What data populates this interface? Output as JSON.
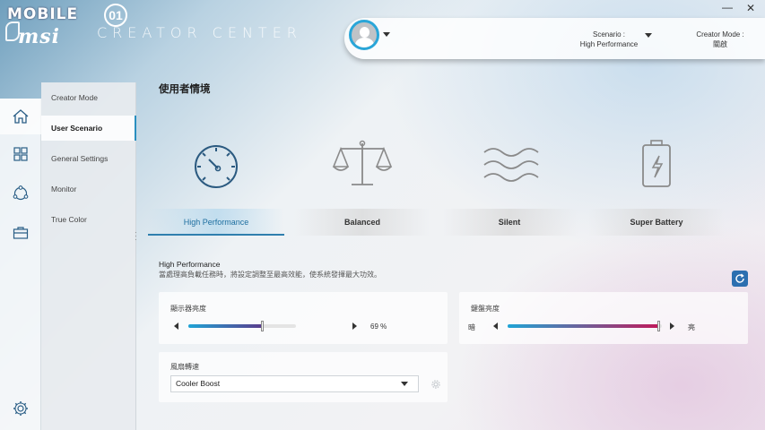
{
  "header": {
    "brand_text": "MOBILE",
    "brand_badge": "01",
    "msi_logo": "msi",
    "app_title": "CREATOR CENTER",
    "scenario_label": "Scenario :",
    "scenario_value": "High Performance",
    "creator_mode_label": "Creator Mode :",
    "creator_mode_value": "關啟",
    "minimize_glyph": "—",
    "close_glyph": "✕"
  },
  "rail": {
    "icons": [
      "home-icon",
      "grid-icon",
      "share-icon",
      "toolbox-icon",
      "gear-icon"
    ],
    "active_index": 0
  },
  "subnav": {
    "items": [
      {
        "label": "Creator Mode"
      },
      {
        "label": "User Scenario"
      },
      {
        "label": "General Settings"
      },
      {
        "label": "Monitor"
      },
      {
        "label": "True Color"
      }
    ],
    "active_index": 1
  },
  "main": {
    "title": "使用者情境",
    "scenarios": [
      {
        "label": "High Performance",
        "icon": "speedometer-icon"
      },
      {
        "label": "Balanced",
        "icon": "scale-icon"
      },
      {
        "label": "Silent",
        "icon": "waves-icon"
      },
      {
        "label": "Super Battery",
        "icon": "battery-icon"
      }
    ],
    "active_scenario": 0,
    "description_title": "High Performance",
    "description_text": "當處理高負載任務時，將設定調整至最高效能，使系統發揮最大功效。",
    "display_brightness": {
      "label": "顯示器亮度",
      "value": 69,
      "value_text": "69 %"
    },
    "keyboard_brightness": {
      "label": "鍵盤亮度",
      "min_label": "暗",
      "max_label": "亮",
      "value": 98
    },
    "fan_speed": {
      "label": "風扇轉速",
      "selected": "Cooler Boost"
    }
  },
  "colors": {
    "accent": "#2a8fbf",
    "display_slider_start": "#1fa4d6",
    "display_slider_end": "#5b3b8c",
    "keyboard_slider_start": "#1fa4d6",
    "keyboard_slider_end": "#c0185a"
  }
}
